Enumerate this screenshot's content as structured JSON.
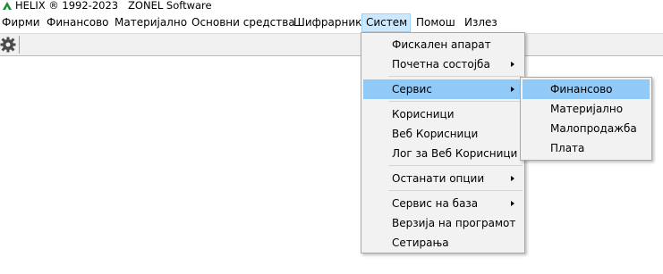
{
  "window": {
    "title": "HELIX ® 1992-2023   ZONEL Software",
    "logo_icon": "helix-logo-icon"
  },
  "menubar": {
    "items": [
      {
        "label": "Фирми"
      },
      {
        "label": "Финансово"
      },
      {
        "label": "Материјално"
      },
      {
        "label": "Основни средства"
      },
      {
        "label": "Шифрарник"
      },
      {
        "label": "Систем"
      },
      {
        "label": "Помош"
      },
      {
        "label": "Излез"
      }
    ],
    "active": "Систем"
  },
  "toolbar": {
    "icon": "gear-icon"
  },
  "system_menu": {
    "items": [
      {
        "label": "Фискален апарат",
        "submenu": false
      },
      {
        "label": "Почетна состојба",
        "submenu": true
      },
      {
        "label": "Сервис",
        "submenu": true,
        "highlighted": true
      },
      {
        "label": "Корисници",
        "submenu": false
      },
      {
        "label": "Веб Корисници",
        "submenu": false
      },
      {
        "label": "Лог за Веб Корисници",
        "submenu": false
      },
      {
        "label": "Останати опции",
        "submenu": true
      },
      {
        "label": "Сервис на база",
        "submenu": true
      },
      {
        "label": "Верзија на програмот",
        "submenu": false
      },
      {
        "label": "Сетирања",
        "submenu": false
      }
    ]
  },
  "service_submenu": {
    "items": [
      {
        "label": "Финансово",
        "highlighted": true
      },
      {
        "label": "Материјално"
      },
      {
        "label": "Малопродажба"
      },
      {
        "label": "Плата"
      }
    ]
  },
  "colors": {
    "highlight": "#91c9f7",
    "menubar_active": "#cce8ff",
    "menu_background": "#f2f2f2"
  }
}
